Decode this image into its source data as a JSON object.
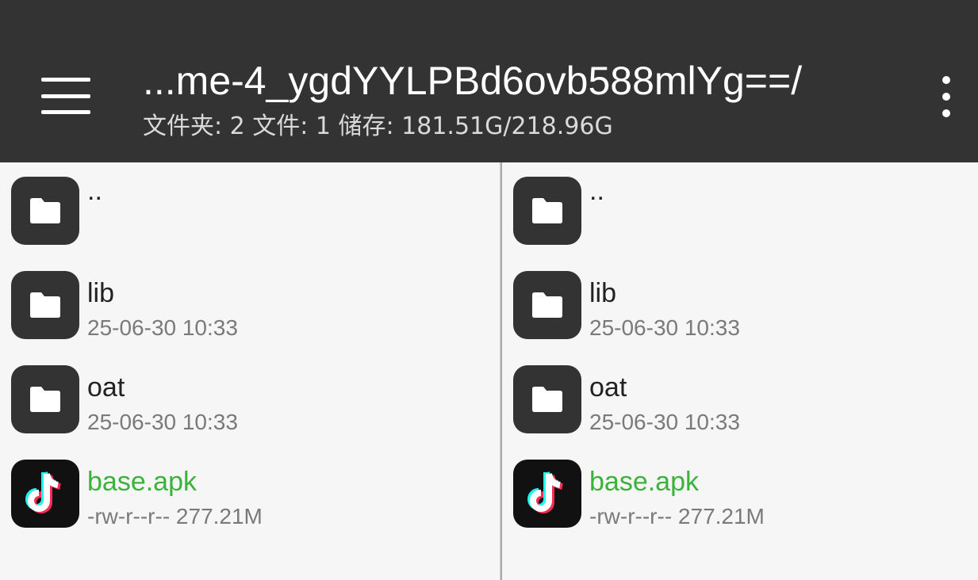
{
  "header": {
    "path": "...me-4_ygdYYLPBd6ovb588mlYg==/",
    "summary": "文件夹: 2  文件: 1  储存: 181.51G/218.96G"
  },
  "left_pane": {
    "items": [
      {
        "name": "..",
        "meta": "",
        "type": "folder",
        "icon": "folder-icon"
      },
      {
        "name": "lib",
        "meta": "25-06-30 10:33",
        "type": "folder",
        "icon": "folder-icon"
      },
      {
        "name": "oat",
        "meta": "25-06-30 10:33",
        "type": "folder",
        "icon": "folder-icon"
      },
      {
        "name": "base.apk",
        "meta": "-rw-r--r--  277.21M",
        "type": "apk",
        "icon": "tiktok-icon"
      }
    ]
  },
  "right_pane": {
    "items": [
      {
        "name": "..",
        "meta": "",
        "type": "folder",
        "icon": "folder-icon"
      },
      {
        "name": "lib",
        "meta": "25-06-30 10:33",
        "type": "folder",
        "icon": "folder-icon"
      },
      {
        "name": "oat",
        "meta": "25-06-30 10:33",
        "type": "folder",
        "icon": "folder-icon"
      },
      {
        "name": "base.apk",
        "meta": "-rw-r--r--  277.21M",
        "type": "apk",
        "icon": "tiktok-icon"
      }
    ]
  },
  "colors": {
    "appbar": "#333333",
    "apk_name": "#3bb33b",
    "meta_text": "#7a7a7a"
  }
}
